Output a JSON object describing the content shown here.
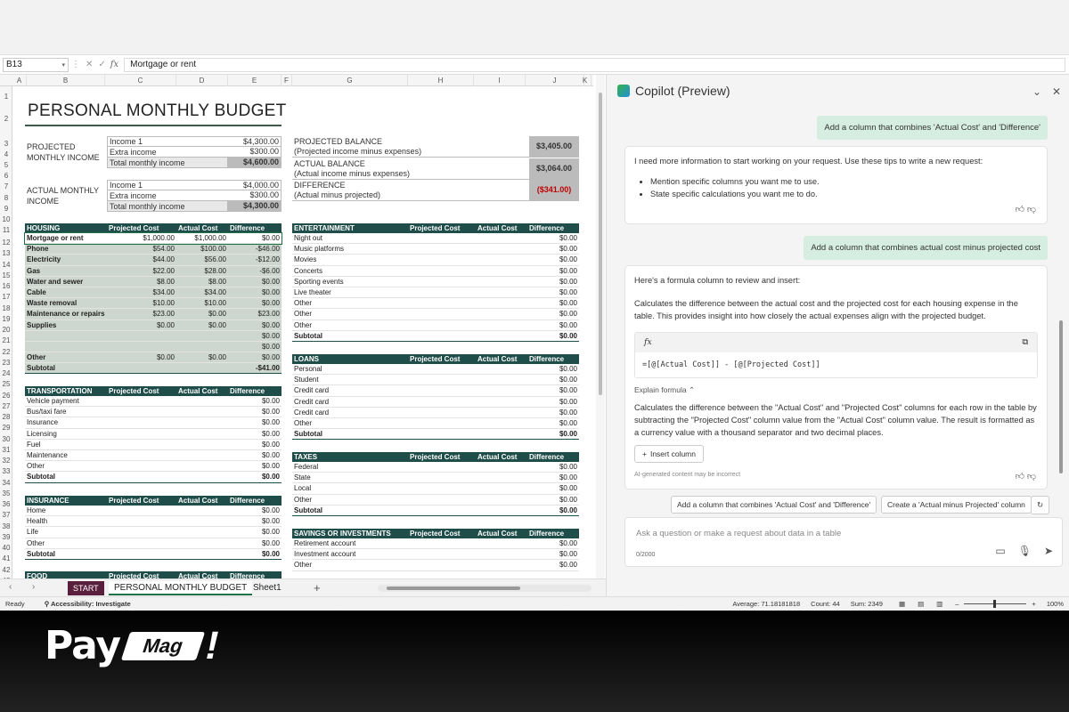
{
  "formula_bar": {
    "name_box": "B13",
    "fx": "fx",
    "value": "Mortgage or rent"
  },
  "columns": [
    "A",
    "B",
    "C",
    "D",
    "E",
    "F",
    "G",
    "H",
    "I",
    "J",
    "K"
  ],
  "rows": [
    "1",
    "2",
    "3",
    "4",
    "5",
    "6",
    "7",
    "8",
    "9",
    "10",
    "11",
    "12",
    "13",
    "14",
    "15",
    "16",
    "17",
    "18",
    "19",
    "20",
    "21",
    "22",
    "23",
    "24",
    "25",
    "26",
    "27",
    "28",
    "29",
    "30",
    "31",
    "32",
    "33",
    "34",
    "35",
    "36",
    "37",
    "38",
    "39",
    "40",
    "41",
    "42",
    "43"
  ],
  "sheet": {
    "title": "PERSONAL MONTHLY BUDGET",
    "projected_income": {
      "label": "PROJECTED MONTHLY INCOME",
      "rows": [
        {
          "k": "Income 1",
          "v": "$4,300.00"
        },
        {
          "k": "Extra income",
          "v": "$300.00"
        },
        {
          "k": "Total monthly income",
          "v": "$4,600.00"
        }
      ]
    },
    "actual_income": {
      "label": "ACTUAL MONTHLY INCOME",
      "rows": [
        {
          "k": "Income 1",
          "v": "$4,000.00"
        },
        {
          "k": "Extra income",
          "v": "$300.00"
        },
        {
          "k": "Total monthly income",
          "v": "$4,300.00"
        }
      ]
    },
    "balance": [
      {
        "l1": "PROJECTED BALANCE",
        "l2": "(Projected income minus expenses)",
        "v": "$3,405.00"
      },
      {
        "l1": "ACTUAL BALANCE",
        "l2": "(Actual income minus expenses)",
        "v": "$3,064.00"
      },
      {
        "l1": "DIFFERENCE",
        "l2": "(Actual minus projected)",
        "v": "($341.00)"
      }
    ],
    "headers": {
      "proj": "Projected Cost",
      "act": "Actual Cost",
      "diff": "Difference"
    },
    "housing": {
      "title": "HOUSING",
      "rows": [
        {
          "n": "Mortgage or rent",
          "p": "$1,000.00",
          "a": "$1,000.00",
          "d": "$0.00"
        },
        {
          "n": "Phone",
          "p": "$54.00",
          "a": "$100.00",
          "d": "-$46.00"
        },
        {
          "n": "Electricity",
          "p": "$44.00",
          "a": "$56.00",
          "d": "-$12.00"
        },
        {
          "n": "Gas",
          "p": "$22.00",
          "a": "$28.00",
          "d": "-$6.00"
        },
        {
          "n": "Water and sewer",
          "p": "$8.00",
          "a": "$8.00",
          "d": "$0.00"
        },
        {
          "n": "Cable",
          "p": "$34.00",
          "a": "$34.00",
          "d": "$0.00"
        },
        {
          "n": "Waste removal",
          "p": "$10.00",
          "a": "$10.00",
          "d": "$0.00"
        },
        {
          "n": "Maintenance or repairs",
          "p": "$23.00",
          "a": "$0.00",
          "d": "$23.00"
        },
        {
          "n": "Supplies",
          "p": "$0.00",
          "a": "$0.00",
          "d": "$0.00"
        },
        {
          "n": "",
          "p": "",
          "a": "",
          "d": "$0.00"
        },
        {
          "n": "",
          "p": "",
          "a": "",
          "d": "$0.00"
        },
        {
          "n": "Other",
          "p": "$0.00",
          "a": "$0.00",
          "d": "$0.00"
        }
      ],
      "subtotal": {
        "n": "Subtotal",
        "d": "-$41.00"
      }
    },
    "transportation": {
      "title": "TRANSPORTATION",
      "rows": [
        {
          "n": "Vehicle payment",
          "d": "$0.00"
        },
        {
          "n": "Bus/taxi fare",
          "d": "$0.00"
        },
        {
          "n": "Insurance",
          "d": "$0.00"
        },
        {
          "n": "Licensing",
          "d": "$0.00"
        },
        {
          "n": "Fuel",
          "d": "$0.00"
        },
        {
          "n": "Maintenance",
          "d": "$0.00"
        },
        {
          "n": "Other",
          "d": "$0.00"
        }
      ],
      "subtotal": {
        "n": "Subtotal",
        "d": "$0.00"
      }
    },
    "insurance": {
      "title": "INSURANCE",
      "rows": [
        {
          "n": "Home",
          "d": "$0.00"
        },
        {
          "n": "Health",
          "d": "$0.00"
        },
        {
          "n": "Life",
          "d": "$0.00"
        },
        {
          "n": "Other",
          "d": "$0.00"
        }
      ],
      "subtotal": {
        "n": "Subtotal",
        "d": "$0.00"
      }
    },
    "food_title": "FOOD",
    "entertainment": {
      "title": "ENTERTAINMENT",
      "rows": [
        {
          "n": "Night out",
          "d": "$0.00"
        },
        {
          "n": "Music platforms",
          "d": "$0.00"
        },
        {
          "n": "Movies",
          "d": "$0.00"
        },
        {
          "n": "Concerts",
          "d": "$0.00"
        },
        {
          "n": "Sporting events",
          "d": "$0.00"
        },
        {
          "n": "Live theater",
          "d": "$0.00"
        },
        {
          "n": "Other",
          "d": "$0.00"
        },
        {
          "n": "Other",
          "d": "$0.00"
        },
        {
          "n": "Other",
          "d": "$0.00"
        }
      ],
      "subtotal": {
        "n": "Subtotal",
        "d": "$0.00"
      }
    },
    "loans": {
      "title": "LOANS",
      "rows": [
        {
          "n": "Personal",
          "d": "$0.00"
        },
        {
          "n": "Student",
          "d": "$0.00"
        },
        {
          "n": "Credit card",
          "d": "$0.00"
        },
        {
          "n": "Credit card",
          "d": "$0.00"
        },
        {
          "n": "Credit card",
          "d": "$0.00"
        },
        {
          "n": "Other",
          "d": "$0.00"
        }
      ],
      "subtotal": {
        "n": "Subtotal",
        "d": "$0.00"
      }
    },
    "taxes": {
      "title": "TAXES",
      "rows": [
        {
          "n": "Federal",
          "d": "$0.00"
        },
        {
          "n": "State",
          "d": "$0.00"
        },
        {
          "n": "Local",
          "d": "$0.00"
        },
        {
          "n": "Other",
          "d": "$0.00"
        }
      ],
      "subtotal": {
        "n": "Subtotal",
        "d": "$0.00"
      }
    },
    "savings": {
      "title": "SAVINGS OR INVESTMENTS",
      "rows": [
        {
          "n": "Retirement account",
          "d": "$0.00"
        },
        {
          "n": "Investment account",
          "d": "$0.00"
        },
        {
          "n": "Other",
          "d": "$0.00"
        }
      ]
    }
  },
  "tabs": {
    "start": "START",
    "active": "PERSONAL MONTHLY BUDGET",
    "sheet1": "Sheet1"
  },
  "status": {
    "ready": "Ready",
    "accessibility": "Accessibility: Investigate",
    "average": "Average: 71.18181818",
    "count": "Count: 44",
    "sum": "Sum: 2349",
    "zoom": "100%"
  },
  "copilot": {
    "title": "Copilot (Preview)",
    "user1": "Add a column that combines 'Actual Cost' and 'Difference'",
    "reply1": {
      "text": "I need more information to start working on your request. Use these tips to write a new request:",
      "tips": [
        "Mention specific columns you want me to use.",
        "State specific calculations you want me to do."
      ]
    },
    "user2": "Add a column that combines actual cost minus projected cost",
    "reply2": {
      "intro": "Here's a formula column to review and insert:",
      "desc": "Calculates the difference between the actual cost and the projected cost for each housing expense in the table. This provides insight into how closely the actual expenses align with the projected budget.",
      "fx": "fx",
      "formula": "=[@[Actual Cost]] - [@[Projected Cost]]",
      "explain_label": "Explain formula",
      "explain": "Calculates the difference between the \"Actual Cost\" and \"Projected Cost\" columns for each row in the table by subtracting the \"Projected Cost\" column value from the \"Actual Cost\" column value. The result is formatted as a currency value with a thousand separator and two decimal places.",
      "insert": "Insert column",
      "disclaimer": "AI-generated content may be incorrect"
    },
    "suggestions": [
      "Add a column that combines 'Actual Cost' and 'Difference'",
      "Create a 'Actual minus Projected' column"
    ],
    "input_placeholder": "Ask a question or make a request about data in a table",
    "char_count": "0/2000"
  },
  "brand": {
    "pay": "Pay",
    "mag": "Mag",
    "bang": "!"
  }
}
